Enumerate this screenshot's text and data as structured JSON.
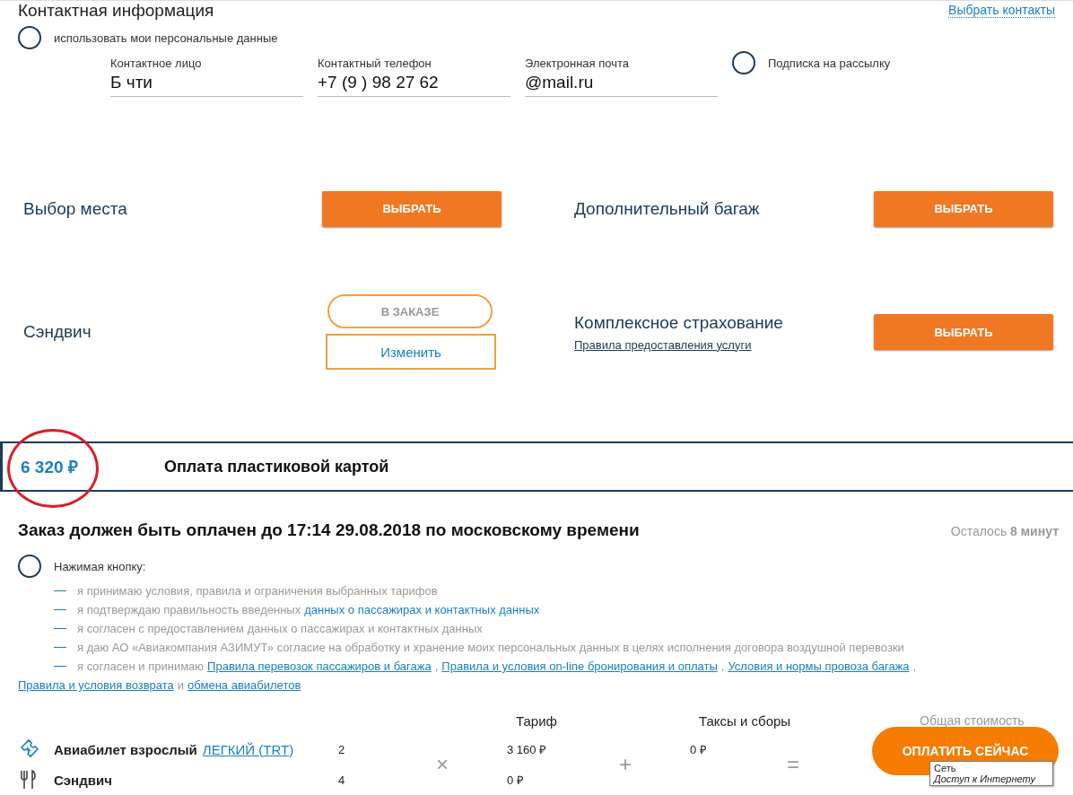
{
  "contact": {
    "title": "Контактная информация",
    "choose_link": "Выбрать контакты",
    "use_personal": {
      "label": "использовать мои персональные данные",
      "checked": false
    },
    "fields": [
      {
        "label": "Контактное лицо",
        "value": "Б  чти"
      },
      {
        "label": "Контактный телефон",
        "value": "+7 (9  ) 98  27 62"
      },
      {
        "label": "Электронная почта",
        "value": "@mail.ru"
      }
    ],
    "subscription": {
      "label": "Подписка на рассылку",
      "checked": false
    }
  },
  "services": [
    {
      "name": "Выбор места",
      "kind": "select",
      "button": "ВЫБРАТЬ"
    },
    {
      "name": "Дополнительный багаж",
      "kind": "select",
      "button": "ВЫБРАТЬ"
    },
    {
      "name": "Сэндвич",
      "kind": "ordered",
      "badge": "В ЗАКАЗЕ",
      "button": "Изменить"
    },
    {
      "name": "Комплексное страхование",
      "link": "Правила предоставления услуги",
      "kind": "select",
      "button": "ВЫБРАТЬ"
    }
  ],
  "payment": {
    "price": "6 320 ₽",
    "method": "Оплата пластиковой картой",
    "circled": true
  },
  "deadline": {
    "text": "Заказ должен быть оплачен до 17:14 29.08.2018 по московскому времени",
    "remaining": "Осталось **8 минут**"
  },
  "consent": {
    "label": "Нажимая кнопку:",
    "checked": false,
    "items": [
      {
        "parts": [
          {
            "kind": "text",
            "text": "я принимаю условия, правила и ограничения выбранных тарифов"
          }
        ]
      },
      {
        "parts": [
          {
            "kind": "text",
            "text": "я подтверждаю правильность введенных"
          },
          {
            "kind": "plainlink",
            "text": "данных о пассажирах и контактных данных"
          }
        ]
      },
      {
        "parts": [
          {
            "kind": "text",
            "text": "я согласен с предоставлением данных о пассажирах и контактных данных"
          }
        ]
      },
      {
        "parts": [
          {
            "kind": "text",
            "text": "я даю АО «Авиакомпания АЗИМУТ» согласие на обработку и хранение моих персональных данных в целях исполнения договора воздушной перевозки"
          }
        ]
      },
      {
        "parts": [
          {
            "kind": "text",
            "text": "я согласен и принимаю"
          },
          {
            "kind": "link",
            "text": "Правила перевозок пассажиров и багажа"
          },
          {
            "kind": "text",
            "text": ","
          },
          {
            "kind": "link",
            "text": "Правила и условия on-line бронирования и оплаты"
          },
          {
            "kind": "text",
            "text": ","
          },
          {
            "kind": "link",
            "text": "Условия и нормы провоза багажа"
          },
          {
            "kind": "text",
            "text": ","
          },
          {
            "kind": "link",
            "text": "Правила и условия возврата"
          },
          {
            "kind": "text",
            "text": "и"
          },
          {
            "kind": "link",
            "text": "обмена авиабилетов"
          }
        ]
      }
    ]
  },
  "summary": {
    "columns": [
      "Тариф",
      "Таксы и сборы",
      "Общая стоимость"
    ],
    "times": "×",
    "plus": "+",
    "equals": "=",
    "rows": [
      {
        "kind": "ticket",
        "name": "Авиабилет взрослый",
        "link": "ЛЕГКИЙ (TRT)",
        "count": "2",
        "tariff": "3 160 ₽",
        "taxes": "0 ₽"
      },
      {
        "kind": "food",
        "name": "Сэндвич",
        "count": "4",
        "tariff": "0 ₽"
      }
    ],
    "pay_button": "ОПЛАТИТЬ СЕЙЧАС"
  },
  "tooltip": {
    "title": "Сеть",
    "text": "Доступ к Интернету"
  }
}
